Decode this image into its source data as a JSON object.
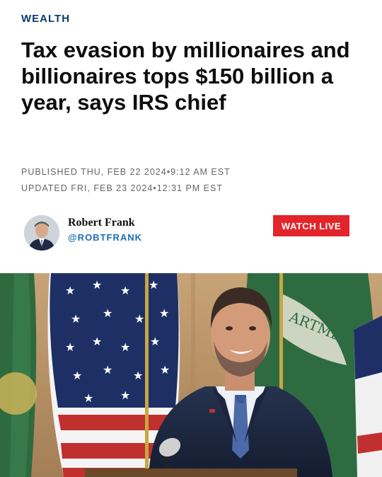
{
  "section": {
    "label": "WEALTH"
  },
  "article": {
    "headline": "Tax evasion by millionaires and billionaires tops $150 billion a year, says IRS chief",
    "published": "PUBLISHED THU, FEB 22 2024•9:12 AM EST",
    "updated": "UPDATED FRI, FEB 23 2024•12:31 PM EST"
  },
  "author": {
    "name": "Robert Frank",
    "handle": "@ROBTFRANK"
  },
  "actions": {
    "watch_live_label": "WATCH LIVE"
  },
  "photo": {
    "seal_text": "ARTMENT"
  },
  "colors": {
    "section": "#0b3c6e",
    "handle": "#1d6fb8",
    "watch_live_bg": "#e2252b",
    "meta": "#666666"
  }
}
